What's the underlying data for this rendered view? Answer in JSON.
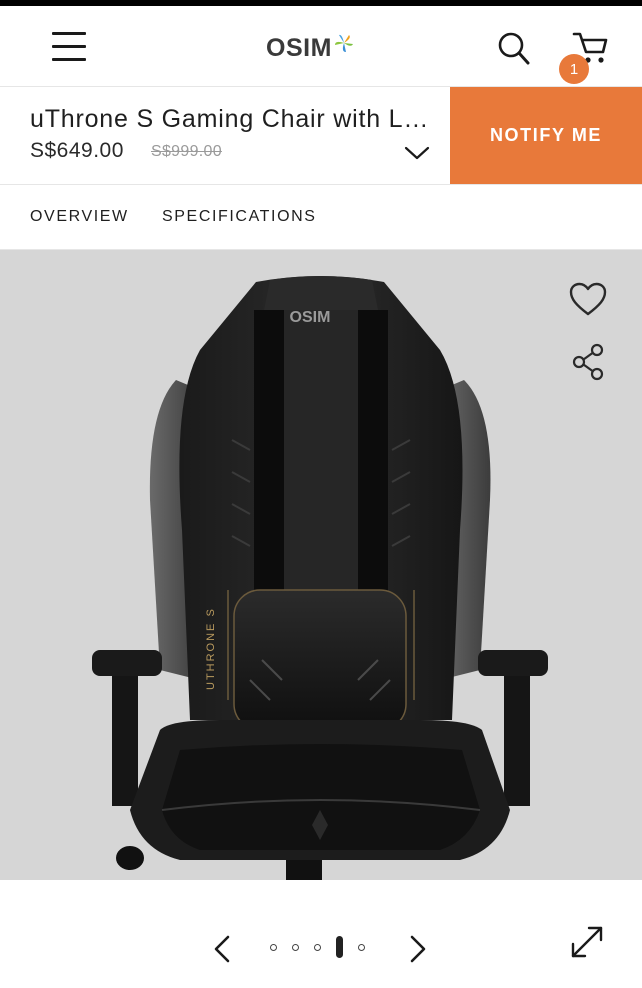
{
  "header": {
    "logo_text": "OSIM",
    "cart_count": "1"
  },
  "product": {
    "name": "uThrone S Gaming Chair with Lumbar Support",
    "price": "S$649.00",
    "original_price": "S$999.00",
    "notify_label": "NOTIFY ME"
  },
  "tabs": [
    {
      "label": "OVERVIEW"
    },
    {
      "label": "SPECIFICATIONS"
    }
  ],
  "gallery": {
    "chair_logo": "OSIM",
    "chair_side_text": "UTHRONE S",
    "slides_total": 5,
    "active_slide": 4
  },
  "colors": {
    "accent": "#e8793a",
    "gallery_bg": "#d6d6d6"
  },
  "icons": [
    "menu-icon",
    "search-icon",
    "cart-icon",
    "heart-icon",
    "share-icon",
    "chevron-down-icon",
    "chevron-left-icon",
    "chevron-right-icon",
    "expand-icon"
  ]
}
